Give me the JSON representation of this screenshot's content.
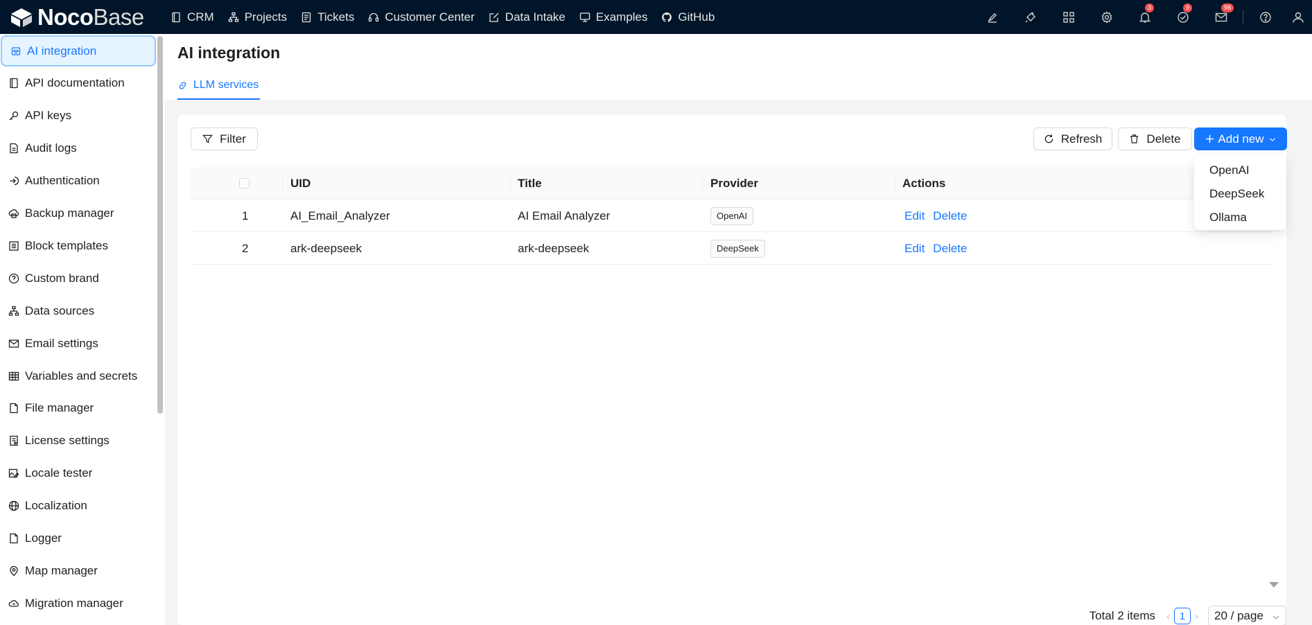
{
  "topbar": {
    "logo_bold": "Noco",
    "logo_light": "Base",
    "nav": [
      {
        "label": "CRM",
        "icon": "book-icon"
      },
      {
        "label": "Projects",
        "icon": "org-chart-icon"
      },
      {
        "label": "Tickets",
        "icon": "list-doc-icon"
      },
      {
        "label": "Customer Center",
        "icon": "headset-icon"
      },
      {
        "label": "Data Intake",
        "icon": "edit-square-icon"
      },
      {
        "label": "Examples",
        "icon": "desktop-icon"
      },
      {
        "label": "GitHub",
        "icon": "github-icon"
      }
    ],
    "badges": {
      "notifications": "3",
      "tasks": "9",
      "mail": "98"
    }
  },
  "sidebar": {
    "items": [
      {
        "label": "AI integration",
        "icon": "robot-icon",
        "active": true
      },
      {
        "label": "API documentation",
        "icon": "book-icon"
      },
      {
        "label": "API keys",
        "icon": "key-icon"
      },
      {
        "label": "Audit logs",
        "icon": "file-text-icon"
      },
      {
        "label": "Authentication",
        "icon": "login-icon"
      },
      {
        "label": "Backup manager",
        "icon": "cloud-server-icon"
      },
      {
        "label": "Block templates",
        "icon": "layout-icon"
      },
      {
        "label": "Custom brand",
        "icon": "question-circle-icon"
      },
      {
        "label": "Data sources",
        "icon": "cluster-icon"
      },
      {
        "label": "Email settings",
        "icon": "mail-icon"
      },
      {
        "label": "Variables and secrets",
        "icon": "table-icon"
      },
      {
        "label": "File manager",
        "icon": "file-icon"
      },
      {
        "label": "License settings",
        "icon": "license-icon"
      },
      {
        "label": "Locale tester",
        "icon": "image-edit-icon"
      },
      {
        "label": "Localization",
        "icon": "global-icon"
      },
      {
        "label": "Logger",
        "icon": "file-icon"
      },
      {
        "label": "Map manager",
        "icon": "location-icon"
      },
      {
        "label": "Migration manager",
        "icon": "cloud-sync-icon"
      }
    ]
  },
  "page": {
    "title": "AI integration",
    "tab_label": "LLM services"
  },
  "toolbar": {
    "filter_label": "Filter",
    "refresh_label": "Refresh",
    "delete_label": "Delete",
    "add_new_label": "Add new"
  },
  "table": {
    "columns": [
      "UID",
      "Title",
      "Provider",
      "Actions"
    ],
    "rows": [
      {
        "index": "1",
        "uid": "AI_Email_Analyzer",
        "title": "AI Email Analyzer",
        "provider": "OpenAI",
        "edit": "Edit",
        "delete": "Delete"
      },
      {
        "index": "2",
        "uid": "ark-deepseek",
        "title": "ark-deepseek",
        "provider": "DeepSeek",
        "edit": "Edit",
        "delete": "Delete"
      }
    ]
  },
  "pagination": {
    "total": "Total 2 items",
    "current": "1",
    "page_size": "20 / page"
  },
  "dropdown": {
    "options": [
      "OpenAI",
      "DeepSeek",
      "Ollama"
    ]
  },
  "colors": {
    "topbar": "#001529",
    "primary": "#1677ff",
    "badge": "#ff4d4f"
  }
}
